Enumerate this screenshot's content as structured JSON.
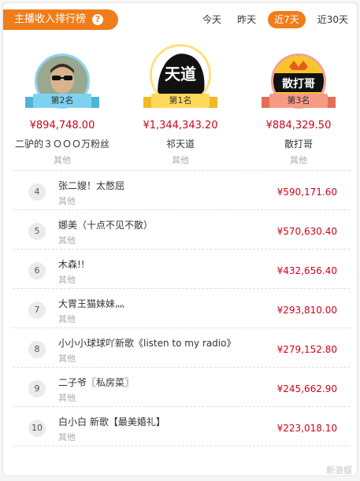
{
  "header": {
    "title": "主播收入排行榜",
    "help_icon": "?",
    "tabs": [
      {
        "label": "今天",
        "active": false
      },
      {
        "label": "昨天",
        "active": false
      },
      {
        "label": "近7天",
        "active": true
      },
      {
        "label": "近30天",
        "active": false
      }
    ]
  },
  "podium": {
    "second": {
      "badge": "第2名",
      "amount": "¥894,748.00",
      "name": "二驴的３ＯＯＯ万粉丝",
      "other": "其他"
    },
    "first": {
      "badge": "第1名",
      "amount": "¥1,344,343.20",
      "name": "祁天道",
      "other": "其他",
      "avatar_text": "天道"
    },
    "third": {
      "badge": "第3名",
      "amount": "¥884,329.50",
      "name": "散打哥",
      "other": "其他",
      "avatar_text": "散打哥"
    }
  },
  "list": [
    {
      "rank": "4",
      "name": "张二嫂！太憋屈",
      "other": "其他",
      "amount": "¥590,171.60"
    },
    {
      "rank": "5",
      "name": "娜美（十点不见不散）",
      "other": "其他",
      "amount": "¥570,630.40"
    },
    {
      "rank": "6",
      "name": "木森!!",
      "other": "其他",
      "amount": "¥432,656.40"
    },
    {
      "rank": "7",
      "name": "大胃王猫妹妹灬",
      "other": "其他",
      "amount": "¥293,810.00"
    },
    {
      "rank": "8",
      "name": "小小小球球吖新歌《listen to my radio》",
      "other": "其他",
      "amount": "¥279,152.80"
    },
    {
      "rank": "9",
      "name": "二子爷〖私房菜〗",
      "other": "其他",
      "amount": "¥245,662.90"
    },
    {
      "rank": "10",
      "name": "白小白 新歌【最美婚礼】",
      "other": "其他",
      "amount": "¥223,018.10"
    }
  ],
  "watermark": "新浪娱",
  "colors": {
    "accent": "#f07d1a",
    "amount": "#d0021b",
    "muted": "#aaaaaa"
  }
}
